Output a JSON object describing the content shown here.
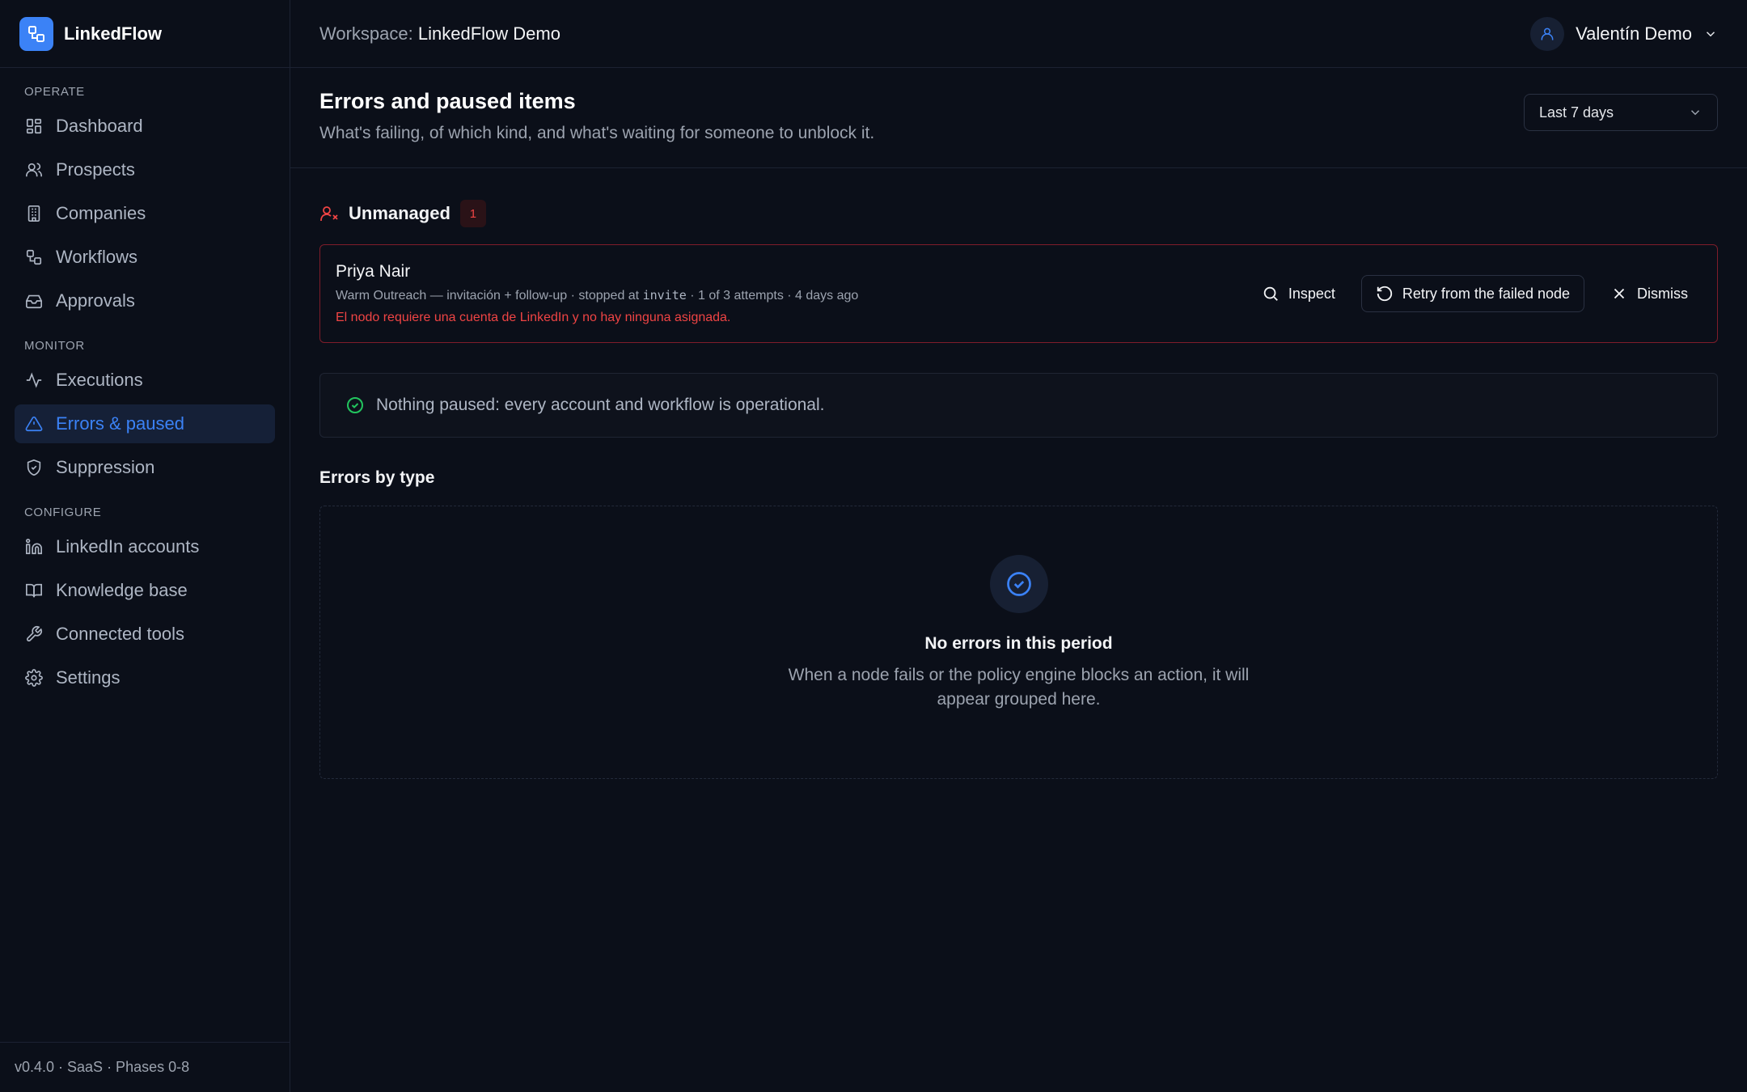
{
  "app": {
    "name": "LinkedFlow",
    "version_info": "v0.4.0 · SaaS · Phases 0-8"
  },
  "topbar": {
    "workspace_label": "Workspace:",
    "workspace_name": "LinkedFlow Demo",
    "user_name": "Valentín Demo"
  },
  "sidebar": {
    "sections": [
      {
        "title": "OPERATE",
        "items": [
          {
            "label": "Dashboard",
            "icon": "dashboard-icon"
          },
          {
            "label": "Prospects",
            "icon": "users-icon"
          },
          {
            "label": "Companies",
            "icon": "building-icon"
          },
          {
            "label": "Workflows",
            "icon": "workflow-icon"
          },
          {
            "label": "Approvals",
            "icon": "inbox-icon"
          }
        ]
      },
      {
        "title": "MONITOR",
        "items": [
          {
            "label": "Executions",
            "icon": "activity-icon"
          },
          {
            "label": "Errors & paused",
            "icon": "warning-icon",
            "active": true
          },
          {
            "label": "Suppression",
            "icon": "shield-icon"
          }
        ]
      },
      {
        "title": "CONFIGURE",
        "items": [
          {
            "label": "LinkedIn accounts",
            "icon": "linkedin-icon"
          },
          {
            "label": "Knowledge base",
            "icon": "book-icon"
          },
          {
            "label": "Connected tools",
            "icon": "wrench-icon"
          },
          {
            "label": "Settings",
            "icon": "gear-icon"
          }
        ]
      }
    ]
  },
  "page": {
    "title": "Errors and paused items",
    "subtitle": "What's failing, of which kind, and what's waiting for someone to unblock it.",
    "period": "Last 7 days"
  },
  "unmanaged": {
    "title": "Unmanaged",
    "count": "1",
    "items": [
      {
        "name": "Priya Nair",
        "meta_prefix": "Warm Outreach — invitación + follow-up · stopped at ",
        "node": "invite",
        "meta_suffix": " · 1 of 3 attempts · 4 days ago",
        "error": "El nodo requiere una cuenta de LinkedIn y no hay ninguna asignada."
      }
    ],
    "actions": {
      "inspect": "Inspect",
      "retry": "Retry from the failed node",
      "dismiss": "Dismiss"
    }
  },
  "paused": {
    "message": "Nothing paused: every account and workflow is operational."
  },
  "errors_by_type": {
    "title": "Errors by type",
    "empty_title": "No errors in this period",
    "empty_desc": "When a node fails or the policy engine blocks an action, it will appear grouped here."
  },
  "colors": {
    "accent": "#3b82f6",
    "danger": "#ef4444",
    "success": "#22c55e",
    "background": "#0b0f19"
  }
}
